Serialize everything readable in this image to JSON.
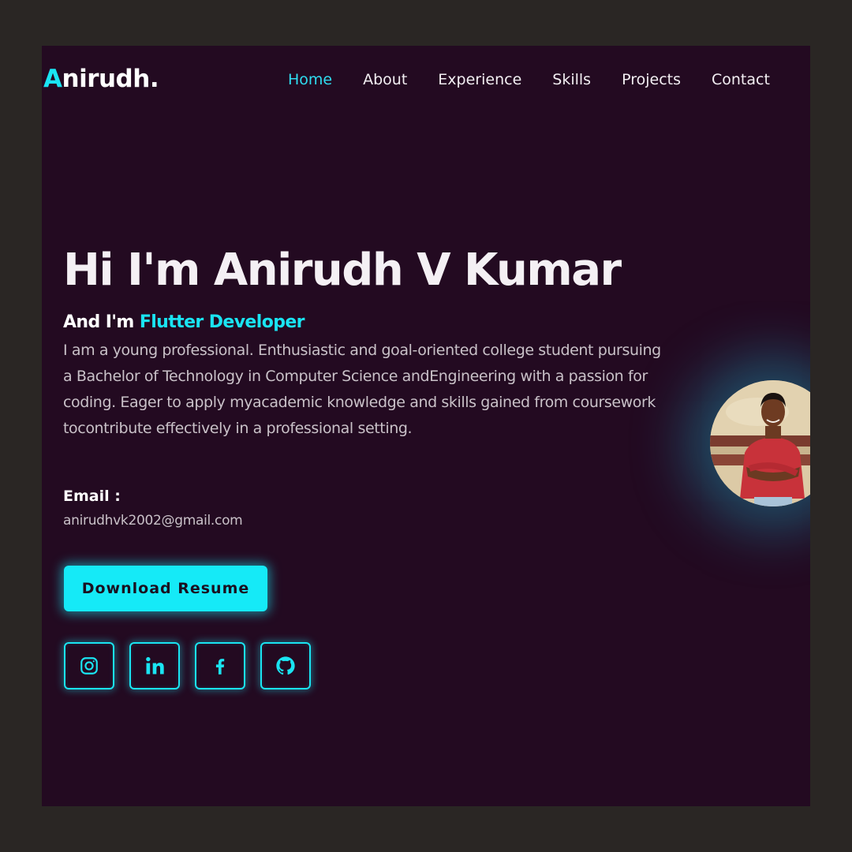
{
  "logo": {
    "first_letter": "A",
    "rest": "nirudh."
  },
  "nav": {
    "items": [
      {
        "label": "Home",
        "active": true
      },
      {
        "label": "About"
      },
      {
        "label": "Experience"
      },
      {
        "label": "Skills"
      },
      {
        "label": "Projects"
      },
      {
        "label": "Contact"
      }
    ]
  },
  "hero": {
    "title": "Hi I'm Anirudh V Kumar",
    "subtitle_prefix": "And I'm ",
    "role": "Flutter Developer",
    "bio": "I am a young professional. Enthusiastic and goal-oriented college student pursuing a Bachelor of Technology in Computer Science andEngineering with a passion for coding. Eager to apply myacademic knowledge and skills gained from coursework tocontribute effectively in a professional setting.",
    "email_label": "Email :",
    "email": "anirudhvk2002@gmail.com",
    "resume_button": "Download Resume"
  },
  "socials": [
    {
      "icon": "instagram-icon"
    },
    {
      "icon": "linkedin-icon"
    },
    {
      "icon": "facebook-icon"
    },
    {
      "icon": "github-icon"
    }
  ],
  "colors": {
    "page_background": "#2a2624",
    "site_background": "#230a21",
    "accent": "#1ae4f2",
    "text_primary": "#ffffff",
    "text_muted": "#c9c1c8"
  }
}
